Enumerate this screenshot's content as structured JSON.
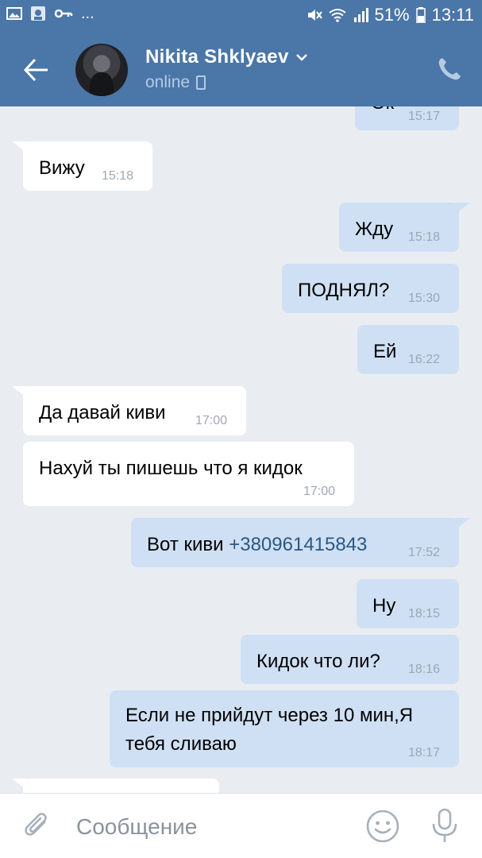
{
  "status_bar": {
    "battery": "51%",
    "time": "13:11",
    "overflow": "..."
  },
  "header": {
    "contact_name": "Nikita Shklyaev",
    "status": "online"
  },
  "messages": [
    {
      "direction": "out",
      "text": "Ок",
      "time": "15:17"
    },
    {
      "direction": "in",
      "text": "Вижу",
      "time": "15:18"
    },
    {
      "direction": "out",
      "text": "Жду",
      "time": "15:18"
    },
    {
      "direction": "out",
      "text": "ПОДНЯЛ?",
      "time": "15:30"
    },
    {
      "direction": "out",
      "text": "Ей",
      "time": "16:22"
    },
    {
      "direction": "in",
      "text": "Да давай киви",
      "time": "17:00"
    },
    {
      "direction": "in",
      "text": "Нахуй ты пишешь что я кидок",
      "time": "17:00"
    },
    {
      "direction": "out",
      "text": "Вот киви ",
      "link": "+380961415843",
      "time": "17:52"
    },
    {
      "direction": "out",
      "text": "Ну",
      "time": "18:15"
    },
    {
      "direction": "out",
      "text": "Кидок что ли?",
      "time": "18:16"
    },
    {
      "direction": "out",
      "line1": "Если не прийдут через 10 мин,Я",
      "line2": "тебя сливаю",
      "time": "18:17"
    }
  ],
  "input": {
    "placeholder": "Сообщение"
  },
  "colors": {
    "header": "#4a76a8",
    "background": "#e9edf2",
    "outgoing_bubble": "#cfe0f4",
    "incoming_bubble": "#ffffff",
    "link": "#2a5885"
  },
  "icons": [
    "gallery-icon",
    "app-icon",
    "key-icon",
    "mute-icon",
    "wifi-icon",
    "signal-icon",
    "battery-icon",
    "back-arrow-icon",
    "chevron-down-icon",
    "mobile-icon",
    "phone-call-icon",
    "paperclip-icon",
    "emoji-icon",
    "microphone-icon"
  ]
}
